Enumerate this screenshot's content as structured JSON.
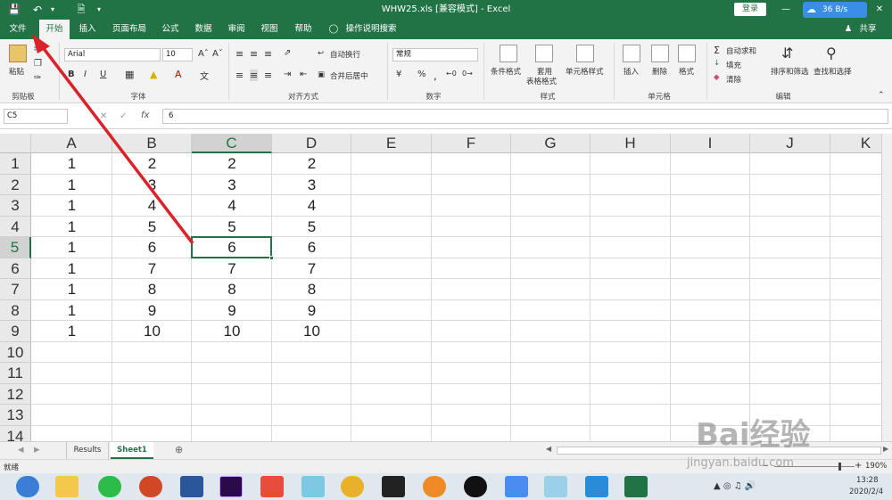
{
  "titlebar": {
    "title": "WHW25.xls  [兼容模式]  -  Excel",
    "login_label": "登录",
    "speed_label": "36 B/s",
    "min_label": "—",
    "close_label": "✕"
  },
  "tabs": [
    "文件",
    "开始",
    "插入",
    "页面布局",
    "公式",
    "数据",
    "审阅",
    "视图",
    "帮助",
    "操作说明搜索"
  ],
  "share_label": "共享",
  "ribbon": {
    "paste_label": "粘贴",
    "clipboard_group": "剪贴板",
    "font_name": "Arial",
    "font_size": "10",
    "bold": "B",
    "italic": "I",
    "underline": "U",
    "font_group": "字体",
    "wrap_label": "自动换行",
    "merge_label": "合并后居中",
    "align_group": "对齐方式",
    "number_format": "常规",
    "number_group": "数字",
    "cond_format_label": "条件格式",
    "table_format_label1": "套用",
    "table_format_label2": "表格格式",
    "cell_style_label": "单元格样式",
    "style_group": "样式",
    "insert_label": "插入",
    "delete_label": "删除",
    "format_label": "格式",
    "cells_group": "单元格",
    "autosum_label": "自动求和",
    "fill_label": "填充",
    "clear_label": "清除",
    "sort_label": "排序和筛选",
    "find_label": "查找和选择",
    "edit_group": "编辑"
  },
  "formula_bar": {
    "name_box": "C5",
    "fx_label": "fx",
    "value": "6"
  },
  "grid": {
    "columns": [
      "A",
      "B",
      "C",
      "D",
      "E",
      "F",
      "G",
      "H",
      "I",
      "J",
      "K"
    ],
    "selected_column": "C",
    "selected_row": "5",
    "rows": [
      {
        "num": "1",
        "cells": [
          "1",
          "2",
          "2",
          "2"
        ]
      },
      {
        "num": "2",
        "cells": [
          "1",
          "3",
          "3",
          "3"
        ]
      },
      {
        "num": "3",
        "cells": [
          "1",
          "4",
          "4",
          "4"
        ]
      },
      {
        "num": "4",
        "cells": [
          "1",
          "5",
          "5",
          "5"
        ]
      },
      {
        "num": "5",
        "cells": [
          "1",
          "6",
          "6",
          "6"
        ]
      },
      {
        "num": "6",
        "cells": [
          "1",
          "7",
          "7",
          "7"
        ]
      },
      {
        "num": "7",
        "cells": [
          "1",
          "8",
          "8",
          "8"
        ]
      },
      {
        "num": "8",
        "cells": [
          "1",
          "9",
          "9",
          "9"
        ]
      },
      {
        "num": "9",
        "cells": [
          "1",
          "10",
          "10",
          "10"
        ]
      },
      {
        "num": "10",
        "cells": [
          "",
          "",
          "",
          ""
        ]
      },
      {
        "num": "11",
        "cells": [
          "",
          "",
          "",
          ""
        ]
      },
      {
        "num": "12",
        "cells": [
          "",
          "",
          "",
          ""
        ]
      },
      {
        "num": "13",
        "cells": [
          "",
          "",
          "",
          ""
        ]
      },
      {
        "num": "14",
        "cells": [
          "",
          "",
          "",
          ""
        ]
      }
    ]
  },
  "sheets": [
    "Results",
    "Sheet1"
  ],
  "active_sheet": "Sheet1",
  "status": {
    "ready": "就绪",
    "zoom": "190%"
  },
  "taskbar": {
    "time": "13:28",
    "date": "2020/2/4"
  },
  "watermark": {
    "brand": "Bai经验",
    "url": "jingyan.baidu.com"
  },
  "colors": {
    "excel_green": "#217346",
    "arrow_red": "#d9222a"
  }
}
